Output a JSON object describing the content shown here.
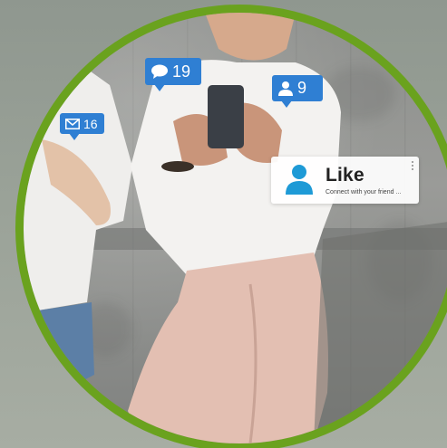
{
  "notifications": {
    "mail": {
      "icon": "envelope-icon",
      "count": "16"
    },
    "comment": {
      "icon": "speech-bubble-icon",
      "count": "19"
    },
    "user": {
      "icon": "user-icon",
      "count": "9"
    }
  },
  "like_card": {
    "icon": "user-avatar-icon",
    "title": "Like",
    "subtitle": "Connect with your friend ..."
  },
  "colors": {
    "ring": "#6aa21e",
    "bubble": "#2f7fd3",
    "avatar": "#1e9ad6"
  }
}
